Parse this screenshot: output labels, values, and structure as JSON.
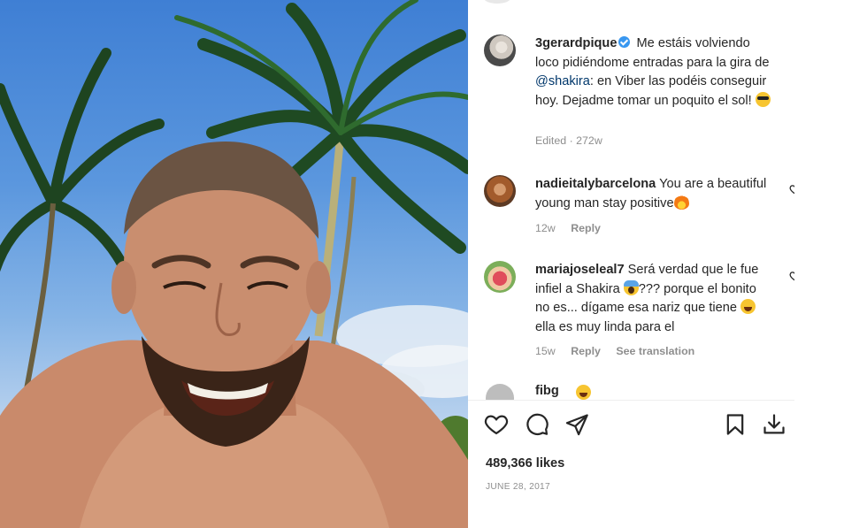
{
  "post": {
    "author": "3gerardpique",
    "caption_parts": {
      "before_mention": "Me estáis volviendo loco pidiéndome entradas para la gira de ",
      "mention": "@shakira",
      "after_mention": ": en Viber las podéis conseguir hoy. Dejadme tomar un poquito el sol! "
    },
    "meta": "Edited · 272w",
    "verified": true
  },
  "comments": [
    {
      "username": "nadieitalybarcelona",
      "text": "You are a beautiful young man stay positive",
      "emoji": "fire-emoji",
      "time": "12w",
      "reply_label": "Reply"
    },
    {
      "username": "mariajoseleal7",
      "text_a": "Será verdad que le fue infiel a Shakira ",
      "text_b": "??? porque el bonito no es... dígame esa nariz que tiene ",
      "text_c": " ella es muy linda para el",
      "time": "15w",
      "reply_label": "Reply",
      "translate_label": "See translation"
    },
    {
      "username": "fibg",
      "text": ""
    }
  ],
  "footer": {
    "likes": "489,366 likes",
    "date": "JUNE 28, 2017"
  },
  "icons": {
    "like": "heart-icon",
    "comment": "comment-icon",
    "share": "send-icon",
    "save": "bookmark-icon",
    "download": "download-icon"
  },
  "colors": {
    "username": "#262626",
    "mention": "#00376b",
    "muted": "#8e8e8e",
    "verified": "#3897f0"
  }
}
